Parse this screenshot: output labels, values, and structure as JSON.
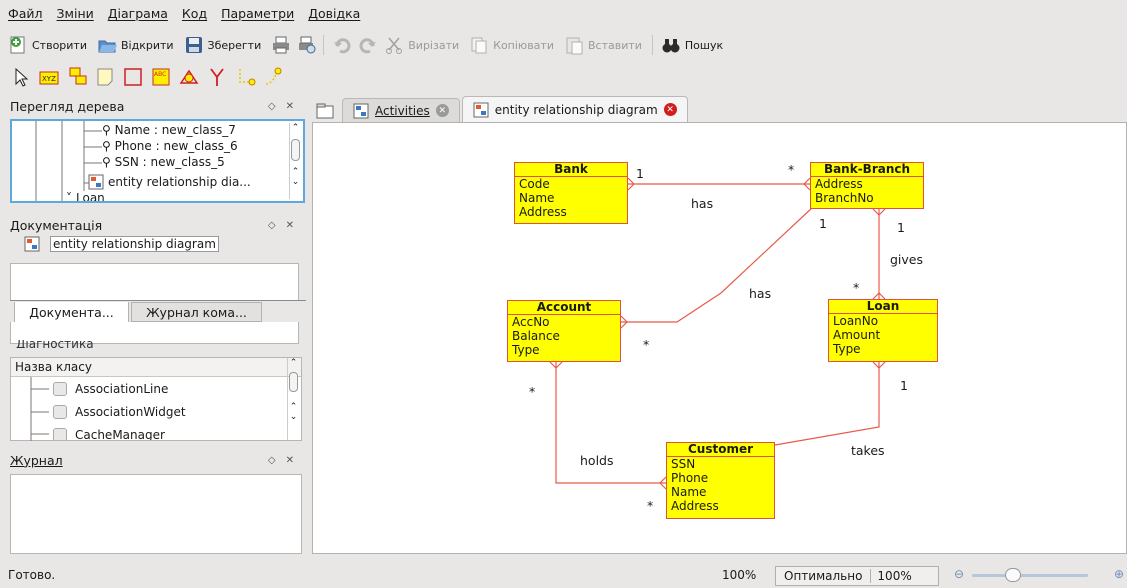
{
  "menu": [
    "Файл",
    "Зміни",
    "Діаграма",
    "Код",
    "Параметри",
    "Довідка"
  ],
  "toolbar": {
    "create": "Створити",
    "open": "Відкрити",
    "save": "Зберегти",
    "cut": "Вирізати",
    "copy": "Копіювати",
    "paste": "Вставити",
    "find": "Пошук"
  },
  "tree_panel": {
    "title": "Перегляд дерева",
    "rows": [
      "Name : new_class_7",
      "Phone : new_class_6",
      "SSN : new_class_5",
      "entity relationship dia...",
      "Loan"
    ]
  },
  "doc_panel": {
    "title": "Документація",
    "diagram_name": "entity relationship diagram",
    "tab_docs": "Документа...",
    "tab_log": "Журнал кома..."
  },
  "class_panel": {
    "header": "Назва класу",
    "overlap_text": "Діагностика",
    "rows": [
      "AssociationLine",
      "AssociationWidget",
      "CacheManager"
    ]
  },
  "log_panel": {
    "title": "Журнал"
  },
  "tabs": [
    {
      "label": "Activities",
      "active": false
    },
    {
      "label": "entity relationship diagram",
      "active": true
    }
  ],
  "diagram": {
    "entities": {
      "bank": {
        "name": "Bank",
        "attrs": [
          "Code",
          "Name",
          "Address"
        ]
      },
      "branch": {
        "name": "Bank-Branch",
        "attrs": [
          "Address",
          "BranchNo"
        ]
      },
      "account": {
        "name": "Account",
        "attrs": [
          "AccNo",
          "Balance",
          "Type"
        ]
      },
      "loan": {
        "name": "Loan",
        "attrs": [
          "LoanNo",
          "Amount",
          "Type"
        ]
      },
      "customer": {
        "name": "Customer",
        "attrs": [
          "SSN",
          "Phone",
          "Name",
          "Address"
        ]
      }
    },
    "labels": {
      "bank_branch_has": "has",
      "bank_mult_1": "1",
      "branch_mult_star": "*",
      "branch_loan_1": "1",
      "gives": "gives",
      "loan_star": "*",
      "branch_account_has": "has",
      "account_star": "*",
      "account_star2": "*",
      "holds": "holds",
      "customer_star": "*",
      "takes": "takes",
      "loan_1": "1"
    },
    "colors": {
      "entity_fill": "#ffff00",
      "entity_border": "#e0513f",
      "line": "#e85a4a"
    }
  },
  "status": {
    "text": "Готово.",
    "zoom_left": "100%",
    "zoom_fit": "Оптимально",
    "zoom_right": "100%"
  }
}
